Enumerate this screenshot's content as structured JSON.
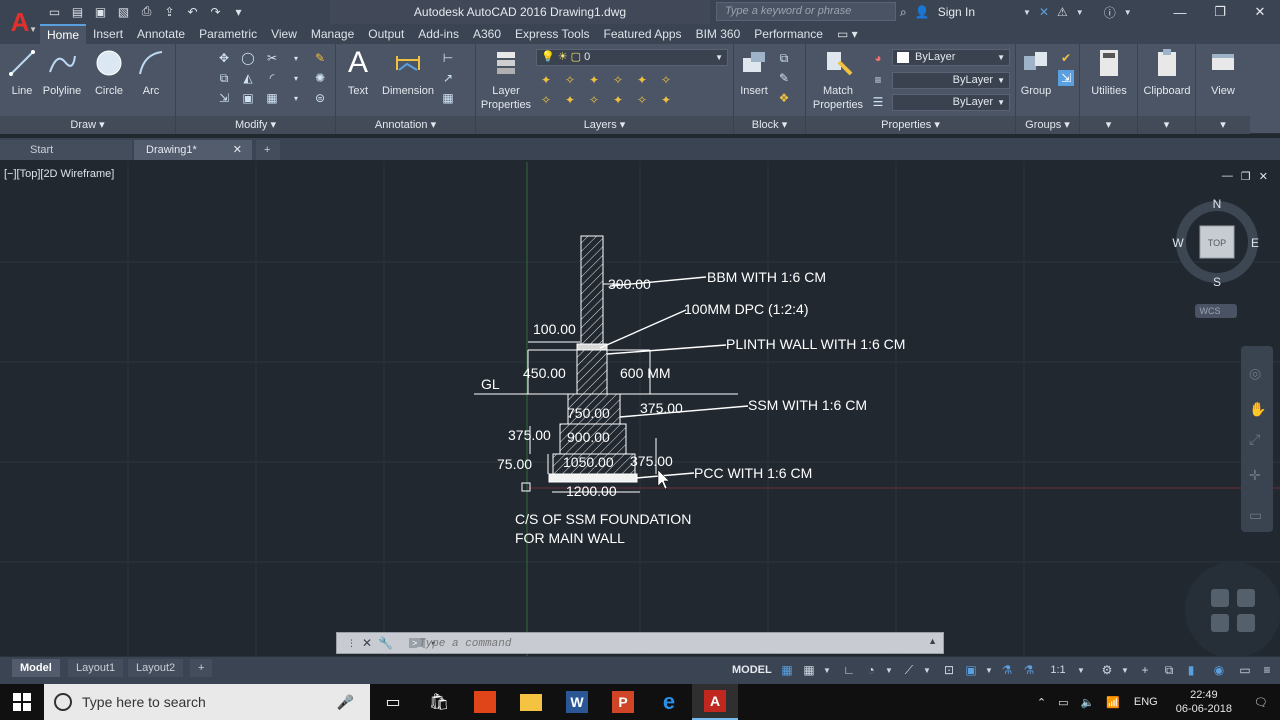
{
  "window": {
    "title": "Autodesk AutoCAD 2016    Drawing1.dwg",
    "search_placeholder": "Type a keyword or phrase",
    "sign_in": "Sign In"
  },
  "ribbon_tabs": [
    "Home",
    "Insert",
    "Annotate",
    "Parametric",
    "View",
    "Manage",
    "Output",
    "Add-ins",
    "A360",
    "Express Tools",
    "Featured Apps",
    "BIM 360",
    "Performance"
  ],
  "panels": {
    "draw": {
      "title": "Draw",
      "buttons": [
        "Line",
        "Polyline",
        "Circle",
        "Arc"
      ]
    },
    "modify": {
      "title": "Modify"
    },
    "annotation": {
      "title": "Annotation",
      "buttons": [
        "Text",
        "Dimension"
      ]
    },
    "layers": {
      "title": "Layers",
      "layer_properties": "Layer Properties",
      "current_layer": "0"
    },
    "block": {
      "title": "Block",
      "insert": "Insert"
    },
    "properties": {
      "title": "Properties",
      "match": "Match Properties",
      "color": "ByLayer",
      "linetype": "ByLayer",
      "lineweight": "ByLayer"
    },
    "groups": {
      "title": "Groups",
      "group": "Group"
    },
    "utilities": "Utilities",
    "clipboard": "Clipboard",
    "view": "View"
  },
  "doc_tabs": {
    "start": "Start",
    "drawing": "Drawing1*"
  },
  "viewport": {
    "label": "[−][Top][2D Wireframe]",
    "viewcube": {
      "n": "N",
      "s": "S",
      "e": "E",
      "w": "W",
      "top": "TOP",
      "wcs": "WCS"
    }
  },
  "drawing": {
    "labels": {
      "bbm": "BBM WITH 1:6 CM",
      "dpc": "100MM DPC (1:2:4)",
      "plinth": "PLINTH WALL WITH 1:6 CM",
      "ssm": "SSM WITH 1:6 CM",
      "pcc": "PCC WITH 1:6 CM",
      "gl": "GL",
      "caption1": "C/S OF SSM FOUNDATION",
      "caption2": "FOR MAIN WALL"
    },
    "dims": {
      "d300": "300.00",
      "d100": "100.00",
      "d450": "450.00",
      "d600": "600 MM",
      "d750": "750.00",
      "d375a": "375.00",
      "d375b": "375.00",
      "d900": "900.00",
      "d75": "75.00",
      "d1050": "1050.00",
      "d375c": "375.00",
      "d1200": "1200.00"
    }
  },
  "command": {
    "placeholder": "Type a command"
  },
  "layout_tabs": [
    "Model",
    "Layout1",
    "Layout2"
  ],
  "status": {
    "model": "MODEL",
    "scale": "1:1"
  },
  "taskbar": {
    "search": "Type here to search",
    "lang": "ENG",
    "time": "22:49",
    "date": "06-06-2018"
  }
}
